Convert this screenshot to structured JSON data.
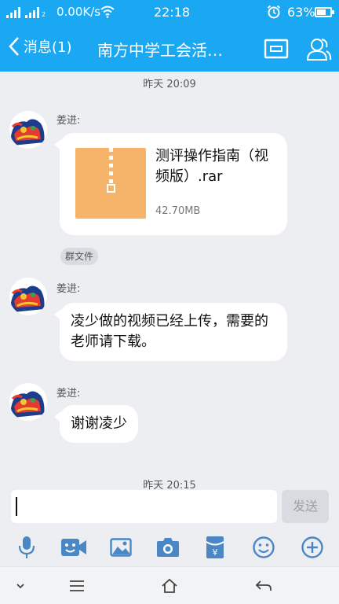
{
  "status_bar": {
    "sim_label": "2",
    "net_speed": "0.00K/s",
    "time": "22:18",
    "battery": "63%"
  },
  "header": {
    "back_label": "消息(1)",
    "title": "南方中学工会活…",
    "accent_color": "#1ba8f2"
  },
  "messages": [
    {
      "timestamp": "昨天 20:09",
      "sender": "姜进:",
      "type": "file",
      "file_name": "测评操作指南（视频版）.rar",
      "file_size": "42.70MB",
      "tag": "群文件"
    },
    {
      "sender": "姜进:",
      "type": "text",
      "text": "凌少做的视频已经上传，需要的老师请下载。"
    },
    {
      "sender": "姜进:",
      "type": "text",
      "text": "谢谢凌少"
    }
  ],
  "partial_timestamp": "昨天 20:15",
  "input": {
    "value": "",
    "send_label": "发送"
  },
  "toolbar_icons": [
    "microphone-icon",
    "video-icon",
    "image-icon",
    "camera-icon",
    "red-packet-icon",
    "emoji-icon",
    "plus-icon"
  ],
  "nav_icons": [
    "chevron-down-icon",
    "menu-icon",
    "home-icon",
    "back-arrow-icon"
  ]
}
